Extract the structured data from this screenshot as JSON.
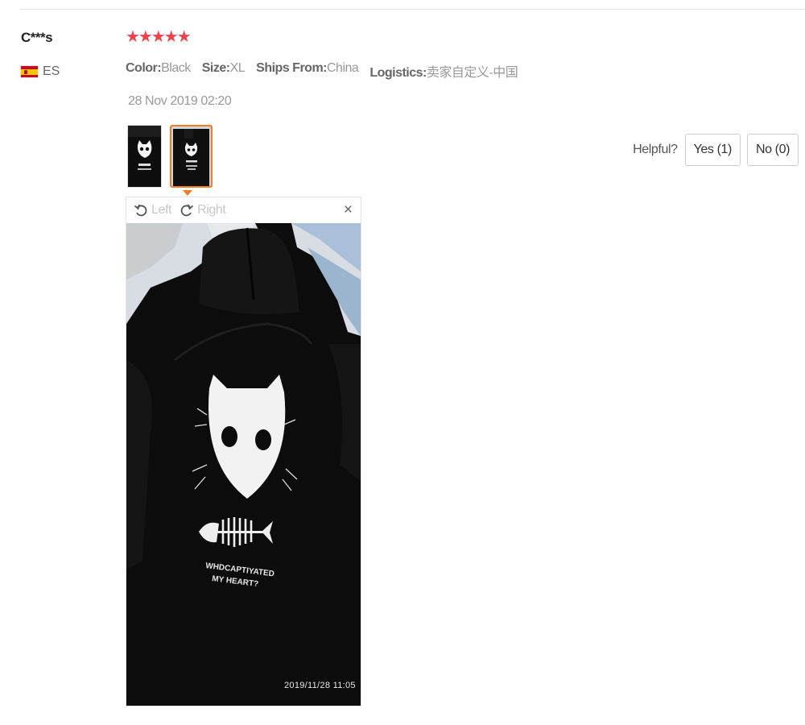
{
  "review": {
    "reviewer": "C***s",
    "country_code": "ES",
    "rating": 5,
    "stars": "★★★★★",
    "attributes": [
      {
        "key": "Color:",
        "value": "Black"
      },
      {
        "key": "Size:",
        "value": "XL"
      },
      {
        "key": "Ships From:",
        "value": "China"
      },
      {
        "key": "Logistics:",
        "value": "卖家自定义-中国"
      }
    ],
    "date": "28 Nov 2019 02:20"
  },
  "helpful": {
    "label": "Helpful?",
    "yes": "Yes (1)",
    "no": "No (0)"
  },
  "viewer": {
    "rotate_left": "Left",
    "rotate_right": "Right",
    "close": "×",
    "photo_print_lines": [
      "WHDCAPTIYATED",
      "MY HEART?"
    ],
    "photo_timestamp": "2019/11/28  11:05"
  },
  "colors": {
    "stars": "#f0424c",
    "active_thumb_border": "#f07c25",
    "muted_text": "#999999"
  }
}
